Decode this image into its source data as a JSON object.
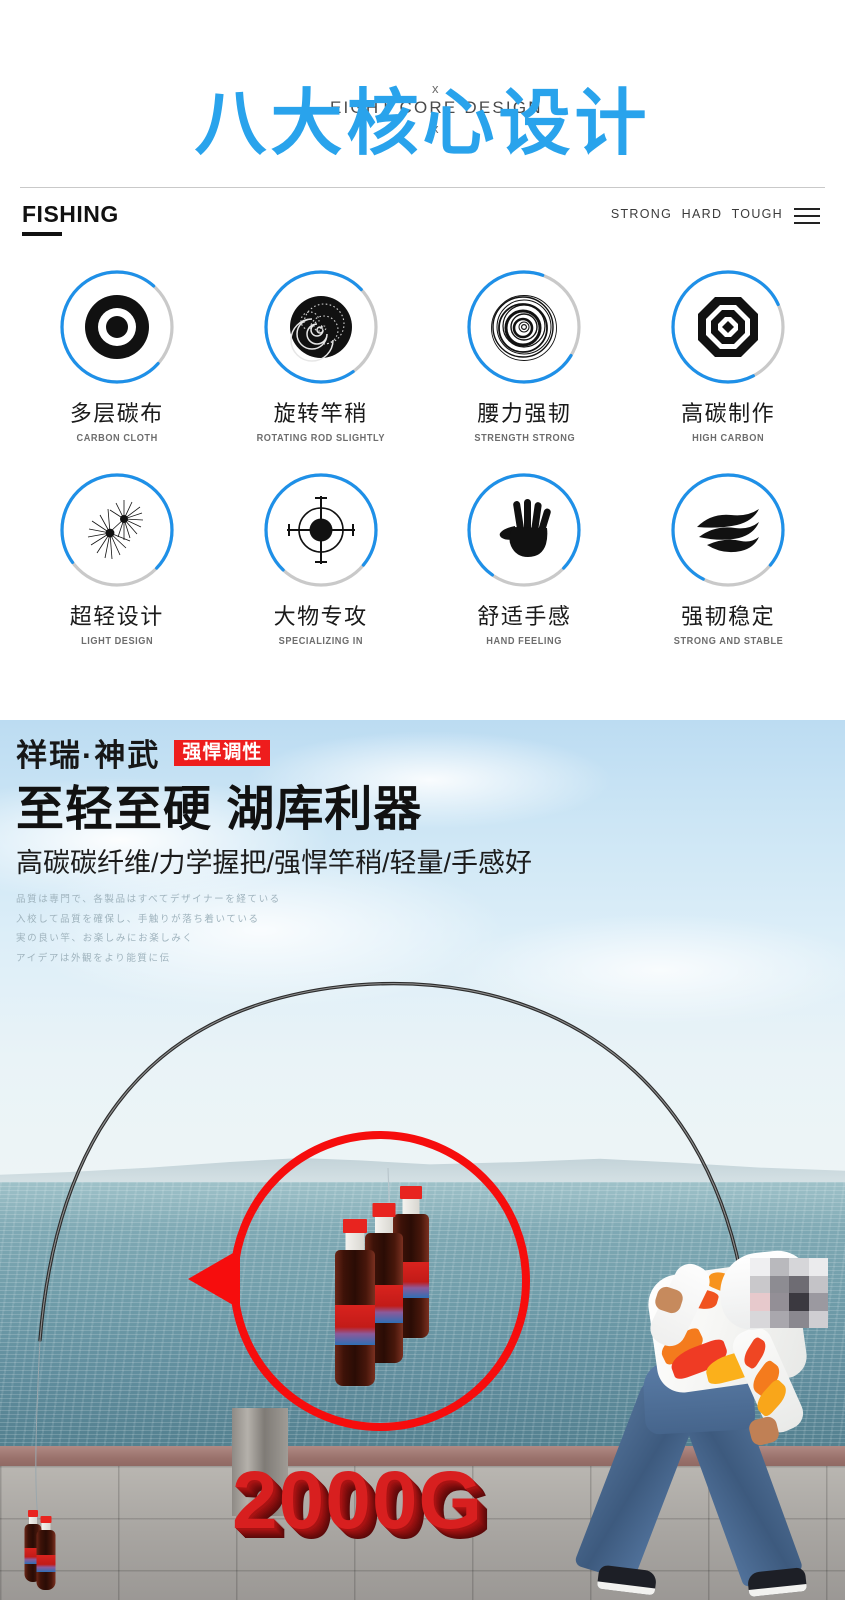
{
  "top": {
    "eyebrow_mark_left": "x",
    "eyebrow_text": "EIGHT CORE DESIGN",
    "eyebrow_mark_right": "x",
    "title": "八大核心设计",
    "title_color": "#29a3ec"
  },
  "nav": {
    "brand": "FISHING",
    "tags": "STRONG  HARD  TOUGH",
    "menu_icon": "hamburger-icon"
  },
  "features": [
    {
      "cn": "多层碳布",
      "en": "CARBON CLOTH",
      "icon": "concentric-target-icon"
    },
    {
      "cn": "旋转竿稍",
      "en": "ROTATING ROD SLIGHTLY",
      "icon": "spiral-disc-icon"
    },
    {
      "cn": "腰力强韧",
      "en": "STRENGTH STRONG",
      "icon": "ripple-rings-icon"
    },
    {
      "cn": "高碳制作",
      "en": "HIGH CARBON",
      "icon": "octagon-layers-icon"
    },
    {
      "cn": "超轻设计",
      "en": "LIGHT DESIGN",
      "icon": "burst-rays-icon"
    },
    {
      "cn": "大物专攻",
      "en": "SPECIALIZING IN",
      "icon": "crosshair-icon"
    },
    {
      "cn": "舒适手感",
      "en": "HAND FEELING",
      "icon": "hand-palm-icon"
    },
    {
      "cn": "强韧稳定",
      "en": "STRONG AND STABLE",
      "icon": "flowing-waves-icon"
    }
  ],
  "ring_colors": {
    "active": "#1e90e8",
    "track": "#c9c9c9"
  },
  "hero": {
    "brand_cn": "祥瑞·神武",
    "badge": "强悍调性",
    "badge_color": "#ee1d1d",
    "headline": "至轻至硬 湖库利器",
    "subline": "高碳碳纤维/力学握把/强悍竿稍/轻量/手感好",
    "jp_lines": [
      "品質は専門で、各製品はすべてデザイナーを経ている",
      "入校して品質を確保し、手触りが落ち着いている",
      "実の良い竿、お楽しみにお楽しみく",
      "アイデアは外観をより能質に伝"
    ],
    "weight_label": "2000G",
    "weight_color": "#d81f1f",
    "callout_color": "#f60d0d"
  }
}
